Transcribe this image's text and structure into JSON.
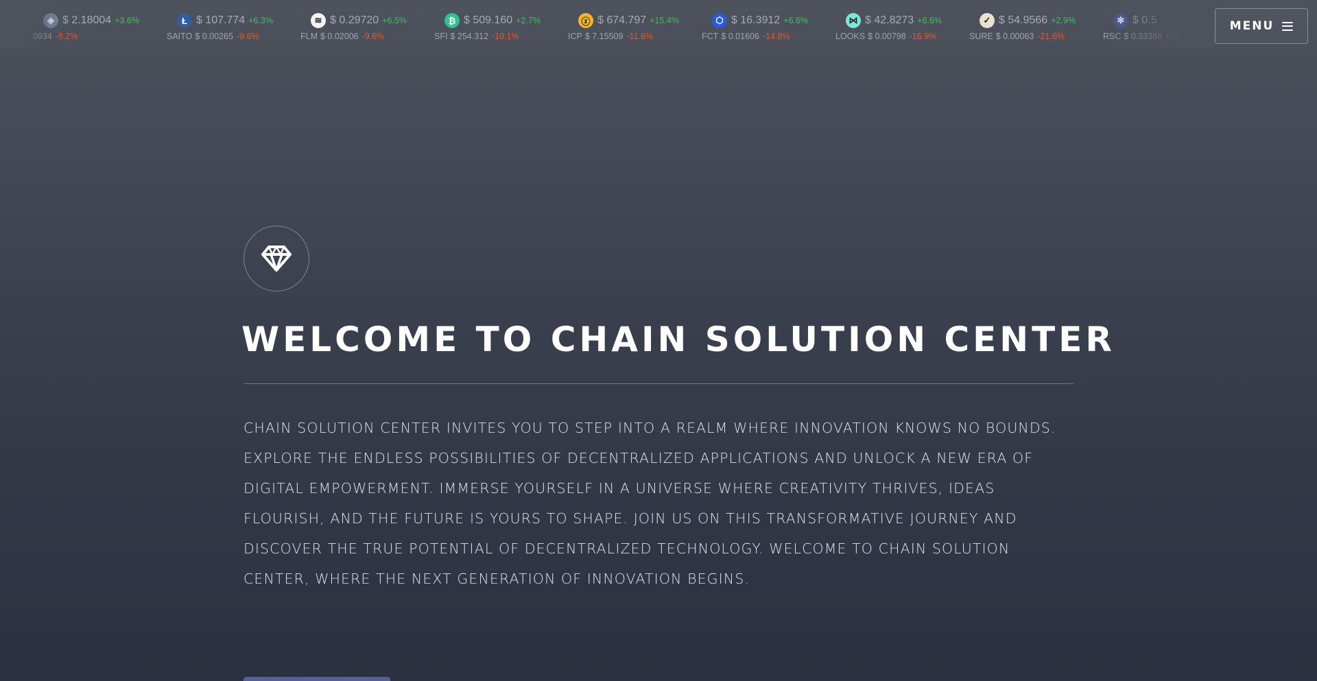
{
  "ticker": {
    "top_row": [
      {
        "icon": "chainlink-coin-icon",
        "icon_bg": "#7a8aa6",
        "icon_glyph": "◈",
        "price": "$ 2.18004",
        "change": "+3.6%"
      },
      {
        "icon": "litecoin-icon",
        "icon_bg": "#345d9d",
        "icon_glyph": "Ł",
        "price": "$ 107.774",
        "change": "+6.3%"
      },
      {
        "icon": "stellar-icon",
        "icon_bg": "#f5f5f5",
        "icon_glyph": "≋",
        "price": "$ 0.29720",
        "change": "+6.5%"
      },
      {
        "icon": "bitcoin-cash-icon",
        "icon_bg": "#2fc48d",
        "icon_glyph": "₿",
        "price": "$ 509.160",
        "change": "+2.7%"
      },
      {
        "icon": "zcash-icon",
        "icon_bg": "#f4b728",
        "icon_glyph": "ⓩ",
        "price": "$ 674.797",
        "change": "+15.4%"
      },
      {
        "icon": "chainlink-icon",
        "icon_bg": "#2a5ada",
        "icon_glyph": "⬡",
        "price": "$ 16.3912",
        "change": "+6.6%"
      },
      {
        "icon": "axie-icon",
        "icon_bg": "#7fe6d4",
        "icon_glyph": "⋈",
        "price": "$ 42.8273",
        "change": "+6.6%"
      },
      {
        "icon": "wrapped-token-icon",
        "icon_bg": "#e8e3d0",
        "icon_glyph": "✓",
        "price": "$ 54.9566",
        "change": "+2.9%"
      },
      {
        "icon": "cosmos-icon",
        "icon_bg": "#4a5a9a",
        "icon_glyph": "✻",
        "price": "$ 0.5",
        "change": ""
      }
    ],
    "bottom_row": [
      {
        "symbol": "",
        "price": "0934",
        "change": "-8.2%"
      },
      {
        "symbol": "SAITO",
        "price": "$ 0.00265",
        "change": "-9.6%"
      },
      {
        "symbol": "FLM",
        "price": "$ 0.02006",
        "change": "-9.6%"
      },
      {
        "symbol": "SFI",
        "price": "$ 254.312",
        "change": "-10.1%"
      },
      {
        "symbol": "ICP",
        "price": "$ 7.15509",
        "change": "-11.6%"
      },
      {
        "symbol": "FCT",
        "price": "$ 0.01606",
        "change": "-14.8%"
      },
      {
        "symbol": "LOOKS",
        "price": "$ 0.00798",
        "change": "-16.9%"
      },
      {
        "symbol": "SURE",
        "price": "$ 0.00063",
        "change": "-21.6%"
      },
      {
        "symbol": "RSC",
        "price": "$ 0.33368",
        "change": "+10.7%"
      }
    ],
    "colors": {
      "up": "#3ac25a",
      "down": "#e8562e"
    }
  },
  "menu": {
    "label": "MENU"
  },
  "hero": {
    "logo_icon": "diamond-icon",
    "title": "WELCOME TO CHAIN SOLUTION CENTER",
    "description": "Chain Solution Center invites you to step into a realm where innovation knows no bounds. Explore the endless possibilities of decentralized applications and unlock a new era of digital empowerment. Immerse yourself in a universe where creativity thrives, ideas flourish, and the future is yours to shape. Join us on this transformative journey and discover the true potential of decentralized technology. Welcome to Chain Solution Center, where the next generation of innovation begins."
  },
  "colors": {
    "background_top": "#4e525d",
    "background_bottom": "#2b3140",
    "cta_button": "#55609b"
  }
}
